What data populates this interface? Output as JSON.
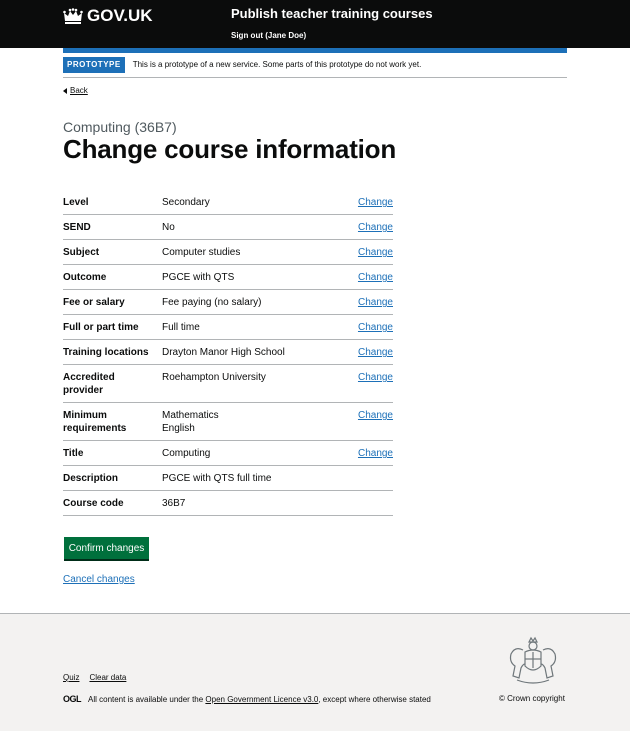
{
  "header": {
    "logo_text": "GOV.UK",
    "service_name": "Publish teacher training courses",
    "sign_out": "Sign out (Jane Doe)"
  },
  "phase_banner": {
    "tag": "PROTOTYPE",
    "text": "This is a prototype of a new service. Some parts of this prototype do not work yet."
  },
  "back_link": "Back",
  "page": {
    "caption": "Computing (36B7)",
    "title": "Change course information"
  },
  "summary": [
    {
      "key": "Level",
      "values": [
        "Secondary"
      ],
      "action": "Change"
    },
    {
      "key": "SEND",
      "values": [
        "No"
      ],
      "action": "Change"
    },
    {
      "key": "Subject",
      "values": [
        "Computer studies"
      ],
      "action": "Change"
    },
    {
      "key": "Outcome",
      "values": [
        "PGCE with QTS"
      ],
      "action": "Change"
    },
    {
      "key": "Fee or salary",
      "values": [
        "Fee paying (no salary)"
      ],
      "action": "Change"
    },
    {
      "key": "Full or part time",
      "values": [
        "Full time"
      ],
      "action": "Change"
    },
    {
      "key": "Training locations",
      "values": [
        "Drayton Manor High School"
      ],
      "action": "Change"
    },
    {
      "key": "Accredited provider",
      "values": [
        "Roehampton University"
      ],
      "action": "Change"
    },
    {
      "key": "Minimum requirements",
      "values": [
        "Mathematics",
        "English"
      ],
      "action": "Change"
    },
    {
      "key": "Title",
      "values": [
        "Computing"
      ],
      "action": "Change"
    },
    {
      "key": "Description",
      "values": [
        "PGCE with QTS full time"
      ],
      "action": ""
    },
    {
      "key": "Course code",
      "values": [
        "36B7"
      ],
      "action": ""
    }
  ],
  "buttons": {
    "confirm": "Confirm changes",
    "cancel": "Cancel changes"
  },
  "footer": {
    "links": [
      "Quiz",
      "Clear data"
    ],
    "ogl_logo": "OGL",
    "licence_prefix": "All content is available under the ",
    "licence_link": "Open Government Licence v3.0",
    "licence_suffix": ", except where otherwise stated",
    "copyright": "© Crown copyright"
  },
  "colors": {
    "header_bg": "#0b0c0c",
    "brand_blue": "#1d70b8",
    "button_green": "#00703c",
    "footer_bg": "#f3f2f1"
  }
}
